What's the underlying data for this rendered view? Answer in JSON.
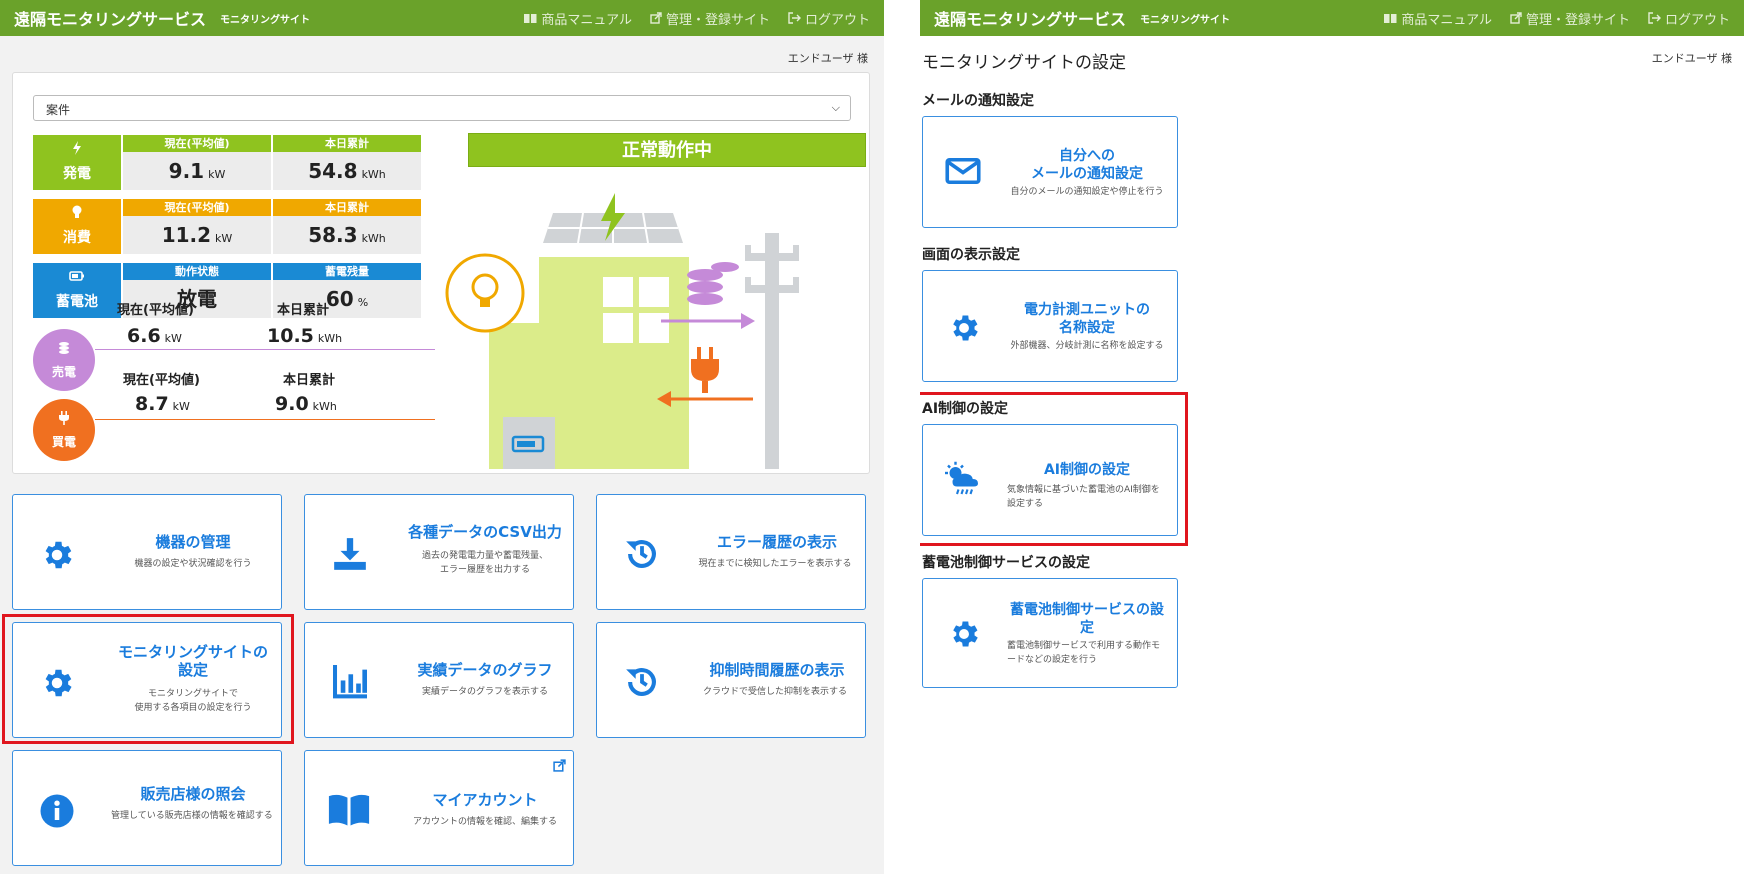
{
  "header": {
    "app_title": "遠隔モニタリングサービス",
    "app_subtitle": "モニタリングサイト",
    "nav_manual": "商品マニュアル",
    "nav_admin": "管理・登録サイト",
    "nav_logout": "ログアウト"
  },
  "user_label": "エンドユーザ 様",
  "project_select": {
    "value": "案件"
  },
  "status_banner": "正常動作中",
  "metrics": {
    "generation": {
      "label": "発電",
      "col1_header": "現在(平均値)",
      "col1_value": "9.1",
      "col1_unit": "kW",
      "col2_header": "本日累計",
      "col2_value": "54.8",
      "col2_unit": "kWh"
    },
    "consumption": {
      "label": "消費",
      "col1_header": "現在(平均値)",
      "col1_value": "11.2",
      "col1_unit": "kW",
      "col2_header": "本日累計",
      "col2_value": "58.3",
      "col2_unit": "kWh"
    },
    "battery": {
      "label": "蓄電池",
      "col1_header": "動作状態",
      "col1_value": "放電",
      "col2_header": "蓄電残量",
      "col2_value": "60",
      "col2_unit": "%"
    },
    "selling": {
      "label": "売電",
      "col1_header": "現在(平均値)",
      "col1_value": "6.6",
      "col1_unit": "kW",
      "col2_header": "本日累計",
      "col2_value": "10.5",
      "col2_unit": "kWh"
    },
    "buying": {
      "label": "買電",
      "col1_header": "現在(平均値)",
      "col1_value": "8.7",
      "col1_unit": "kW",
      "col2_header": "本日累計",
      "col2_value": "9.0",
      "col2_unit": "kWh"
    }
  },
  "menu_tiles": [
    {
      "title": "機器の管理",
      "desc": "機器の設定や状況確認を行う"
    },
    {
      "title": "各種データのCSV出力",
      "desc": "過去の発電電力量や蓄電残量、\nエラー履歴を出力する"
    },
    {
      "title": "エラー履歴の表示",
      "desc": "現在までに検知したエラーを表示する"
    },
    {
      "title": "モニタリングサイトの\n設定",
      "desc": "モニタリングサイトで\n使用する各項目の設定を行う"
    },
    {
      "title": "実績データのグラフ",
      "desc": "実績データのグラフを表示する"
    },
    {
      "title": "抑制時間履歴の表示",
      "desc": "クラウドで受信した抑制を表示する"
    },
    {
      "title": "販売店様の照会",
      "desc": "管理している販売店様の情報を確認する"
    },
    {
      "title": "マイアカウント",
      "desc": "アカウントの情報を確認、編集する"
    }
  ],
  "settings_page": {
    "title": "モニタリングサイトの設定",
    "sections": [
      {
        "heading": "メールの通知設定",
        "tile_title": "自分への\nメールの通知設定",
        "tile_desc": "自分のメールの通知設定や停止を行う"
      },
      {
        "heading": "画面の表示設定",
        "tile_title": "電力計測ユニットの\n名称設定",
        "tile_desc": "外部機器、分岐計測に名称を設定する"
      },
      {
        "heading": "AI制御の設定",
        "tile_title": "AI制御の設定",
        "tile_desc": "気象情報に基づいた蓄電池のAI制御を\n設定する"
      },
      {
        "heading": "蓄電池制御サービスの設定",
        "tile_title": "蓄電池制御サービスの設\n定",
        "tile_desc": "蓄電池制御サービスで利用する動作モ\nードなどの設定を行う"
      }
    ]
  },
  "colors": {
    "header_green": "#6aa22a",
    "generation": "#8fc31f",
    "consumption": "#f0a800",
    "battery": "#1a8ad4",
    "selling": "#c58ad8",
    "buying": "#f07020",
    "link_blue": "#1a7cdd",
    "highlight_red": "#e0161e"
  }
}
